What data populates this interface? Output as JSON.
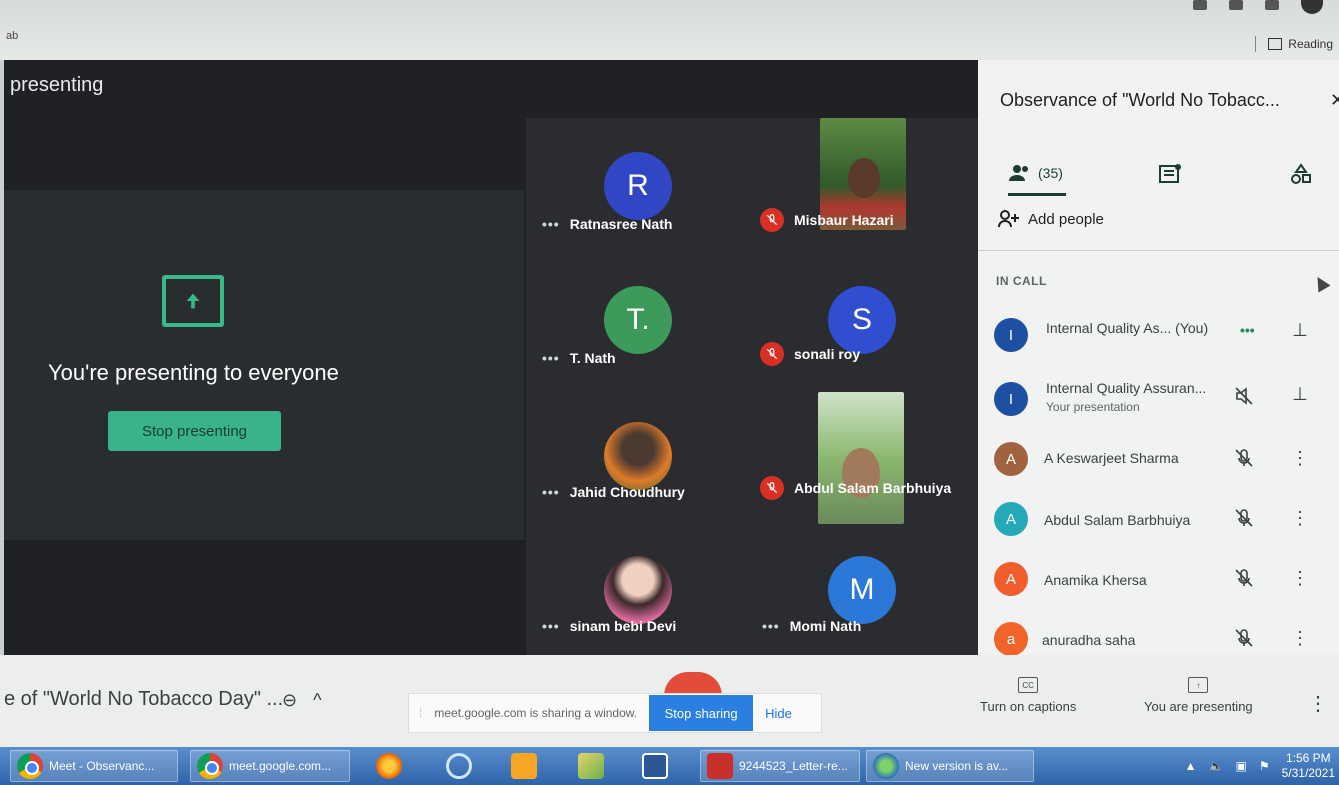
{
  "browser": {
    "tab_fragment": "ab",
    "reading_label": "Reading"
  },
  "meet": {
    "presenting_label": "presenting",
    "presenting_message": "You're presenting to everyone",
    "stop_presenting_label": "Stop presenting",
    "tiles": [
      {
        "name": "Ratnasree Nath",
        "initial": "R",
        "color": "#3046c4",
        "muted": false
      },
      {
        "name": "Misbaur Hazari",
        "initial": "",
        "color": "",
        "muted": true
      },
      {
        "name": "T. Nath",
        "initial": "T.",
        "color": "#3c9a5a",
        "muted": false
      },
      {
        "name": "sonali roy",
        "initial": "S",
        "color": "#2f4fd0",
        "muted": true
      },
      {
        "name": "Jahid Choudhury",
        "initial": "",
        "color": "",
        "muted": false
      },
      {
        "name": "Abdul Salam Barbhuiya",
        "initial": "",
        "color": "",
        "muted": true
      },
      {
        "name": "sinam bebi Devi",
        "initial": "",
        "color": "",
        "muted": false
      },
      {
        "name": "Momi Nath",
        "initial": "M",
        "color": "#2b78d8",
        "muted": false
      }
    ]
  },
  "sidebar": {
    "title": "Observance of \"World No Tobacc...",
    "people_count": "(35)",
    "add_people_label": "Add people",
    "in_call_label": "IN CALL",
    "people": [
      {
        "initial": "I",
        "name": "Internal Quality As... (You)",
        "sub": "",
        "color": "#1d4fa3"
      },
      {
        "initial": "I",
        "name": "Internal Quality Assuran...",
        "sub": "Your presentation",
        "color": "#1d4fa3"
      },
      {
        "initial": "A",
        "name": "A Keswarjeet Sharma",
        "sub": "",
        "color": "#a0623f"
      },
      {
        "initial": "A",
        "name": "Abdul Salam Barbhuiya",
        "sub": "",
        "color": "#25a8b8"
      },
      {
        "initial": "A",
        "name": "Anamika Khersa",
        "sub": "",
        "color": "#f25d2e"
      },
      {
        "initial": "a",
        "name": "anuradha saha",
        "sub": "",
        "color": "#f0642a"
      }
    ]
  },
  "bottom": {
    "meeting_name": "e of \"World No Tobacco Day\" ...",
    "sharing_text": "meet.google.com is sharing a window.",
    "stop_sharing_label": "Stop sharing",
    "hide_label": "Hide",
    "captions_label": "Turn on captions",
    "you_presenting_label": "You are presenting"
  },
  "taskbar": {
    "items": [
      {
        "label": "Meet - Observanc..."
      },
      {
        "label": "meet.google.com..."
      },
      {
        "label": "9244523_Letter-re..."
      },
      {
        "label": "New version is av..."
      }
    ],
    "time": "1:56 PM",
    "date": "5/31/2021"
  }
}
